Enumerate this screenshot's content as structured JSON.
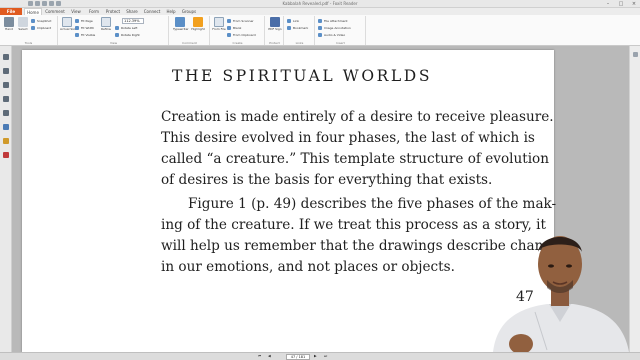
{
  "window": {
    "title": "Kabbalah Revealed.pdf - Foxit Reader"
  },
  "menu": {
    "file_tab": "File",
    "tabs": [
      "Home",
      "Comment",
      "View",
      "Form",
      "Protect",
      "Share",
      "Connect",
      "Help",
      "Groups"
    ]
  },
  "ribbon": {
    "tools": {
      "hand": "Hand",
      "select": "Select",
      "snapshot": "SnapShot",
      "clipboard": "Clipboard",
      "label": "Tools"
    },
    "view": {
      "actual_size": "Actual Size",
      "fit_page": "Fit Page",
      "fit_width": "Fit Width",
      "fit_visible": "Fit Visible",
      "reflow": "Reflow",
      "zoom_value": "112.39%",
      "rotate_left": "Rotate Left",
      "rotate_right": "Rotate Right",
      "label": "View"
    },
    "comment": {
      "typewriter": "Typewriter",
      "highlight": "Highlight",
      "label": "Comment"
    },
    "create": {
      "from_file": "From File",
      "from_scanner": "From Scanner",
      "blank": "Blank",
      "from_clipboard": "From Clipboard",
      "label": "Create"
    },
    "protect": {
      "pdf_sign": "PDF Sign",
      "label": "Protect"
    },
    "links": {
      "link": "Link",
      "bookmark": "Bookmark",
      "label": "Links"
    },
    "insert": {
      "file_attachment": "File Attachment",
      "image_annotation": "Image Annotation",
      "audio_video": "Audio & Video",
      "label": "Insert"
    }
  },
  "document": {
    "heading": "THE SPIRITUAL WORLDS",
    "paragraph1": [
      "Creation is made entirely of a desire to receive pleasure.",
      "This desire evolved in four phases, the last of which is",
      "called “a creature.” This template structure of evolution",
      "of desires is the basis for everything that exists."
    ],
    "paragraph2": [
      "Figure 1 (p. 49) describes the five phases of the mak-",
      "ing of the creature. If we treat this process as a story, it",
      "will help us remember that the drawings describe changes",
      "in our emotions, and not places or objects."
    ],
    "page_number": "47"
  },
  "status": {
    "page_field": "47 / 181"
  },
  "colors": {
    "file_tab": "#e05a1f",
    "accent": "#5b8fc7",
    "highlight": "#f2a01e"
  }
}
